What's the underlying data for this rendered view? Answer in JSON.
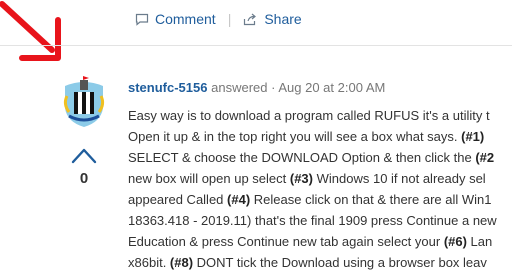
{
  "actions": {
    "comment_label": "Comment",
    "share_label": "Share",
    "separator": "|"
  },
  "answer": {
    "username": "stenufc-5156",
    "action": "answered",
    "dot": "·",
    "date": "Aug 20 at 2:00 AM",
    "score": "0",
    "lines": [
      [
        {
          "t": "Easy way is to download a program called RUFUS it's a utility t"
        }
      ],
      [
        {
          "t": "Open it up & in the top right you will see a box what says. "
        },
        {
          "t": "(#1)",
          "b": true
        }
      ],
      [
        {
          "t": "SELECT & choose the DOWNLOAD Option & then click the "
        },
        {
          "t": "(#2",
          "b": true
        }
      ],
      [
        {
          "t": "new box will open up select "
        },
        {
          "t": "(#3)",
          "b": true
        },
        {
          "t": " Windows 10 if not already sel"
        }
      ],
      [
        {
          "t": "appeared Called "
        },
        {
          "t": "(#4)",
          "b": true
        },
        {
          "t": " Release click on that & there are all Win1"
        }
      ],
      [
        {
          "t": "18363.418 - 2019.11) that's the final 1909 press Continue a new"
        }
      ],
      [
        {
          "t": "Education & press Continue new tab again select your "
        },
        {
          "t": "(#6)",
          "b": true
        },
        {
          "t": " Lan"
        }
      ],
      [
        {
          "t": "x86bit. "
        },
        {
          "t": "(#8)",
          "b": true
        },
        {
          "t": " DONT tick the Download using a browser box leav"
        }
      ]
    ]
  },
  "colors": {
    "link": "#1f5d9c",
    "annotation_arrow": "#e8141b",
    "avatar_bg": "#8ccbe8"
  },
  "icons": {
    "comment": "comment-icon",
    "share": "share-icon",
    "upvote": "upvote-chevron-icon",
    "arrow": "red-arrow-annotation-icon"
  }
}
